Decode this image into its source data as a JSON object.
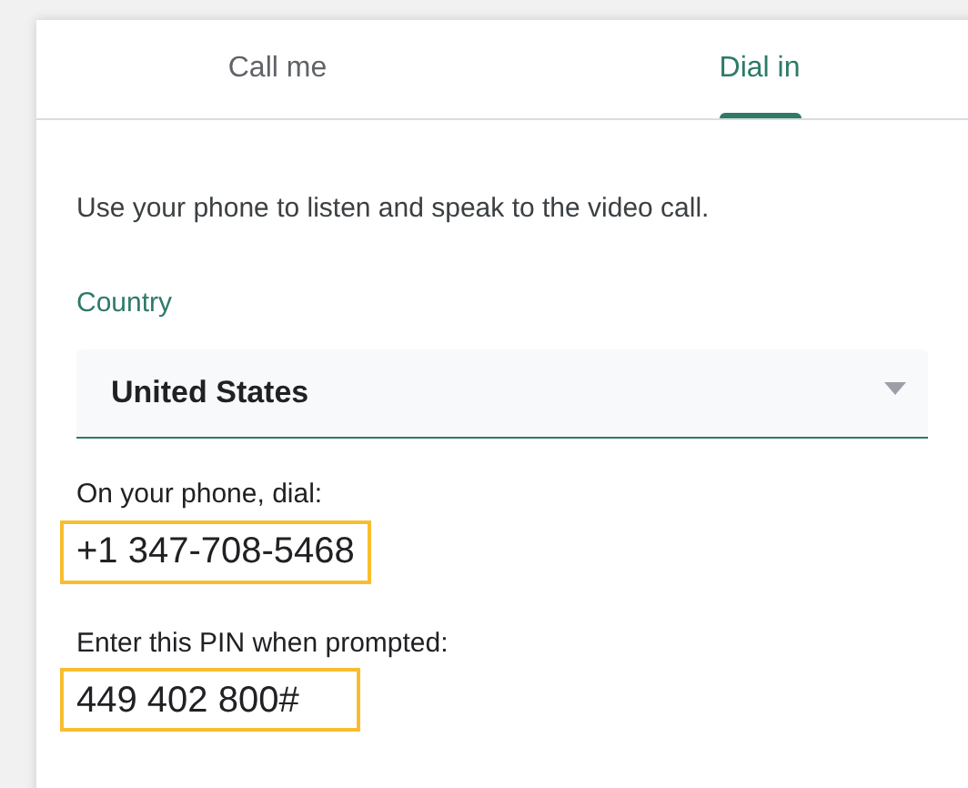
{
  "tabs": [
    {
      "label": "Call me",
      "selected": false
    },
    {
      "label": "Dial in",
      "selected": true
    }
  ],
  "description": "Use your phone to listen and speak to the video call.",
  "country": {
    "label": "Country",
    "value": "United States"
  },
  "dial": {
    "label": "On your phone, dial:",
    "value": "+1 347-708-5468",
    "highlighted": true
  },
  "pin": {
    "label": "Enter this PIN when prompted:",
    "value": "449 402 800#",
    "highlighted": true
  }
}
